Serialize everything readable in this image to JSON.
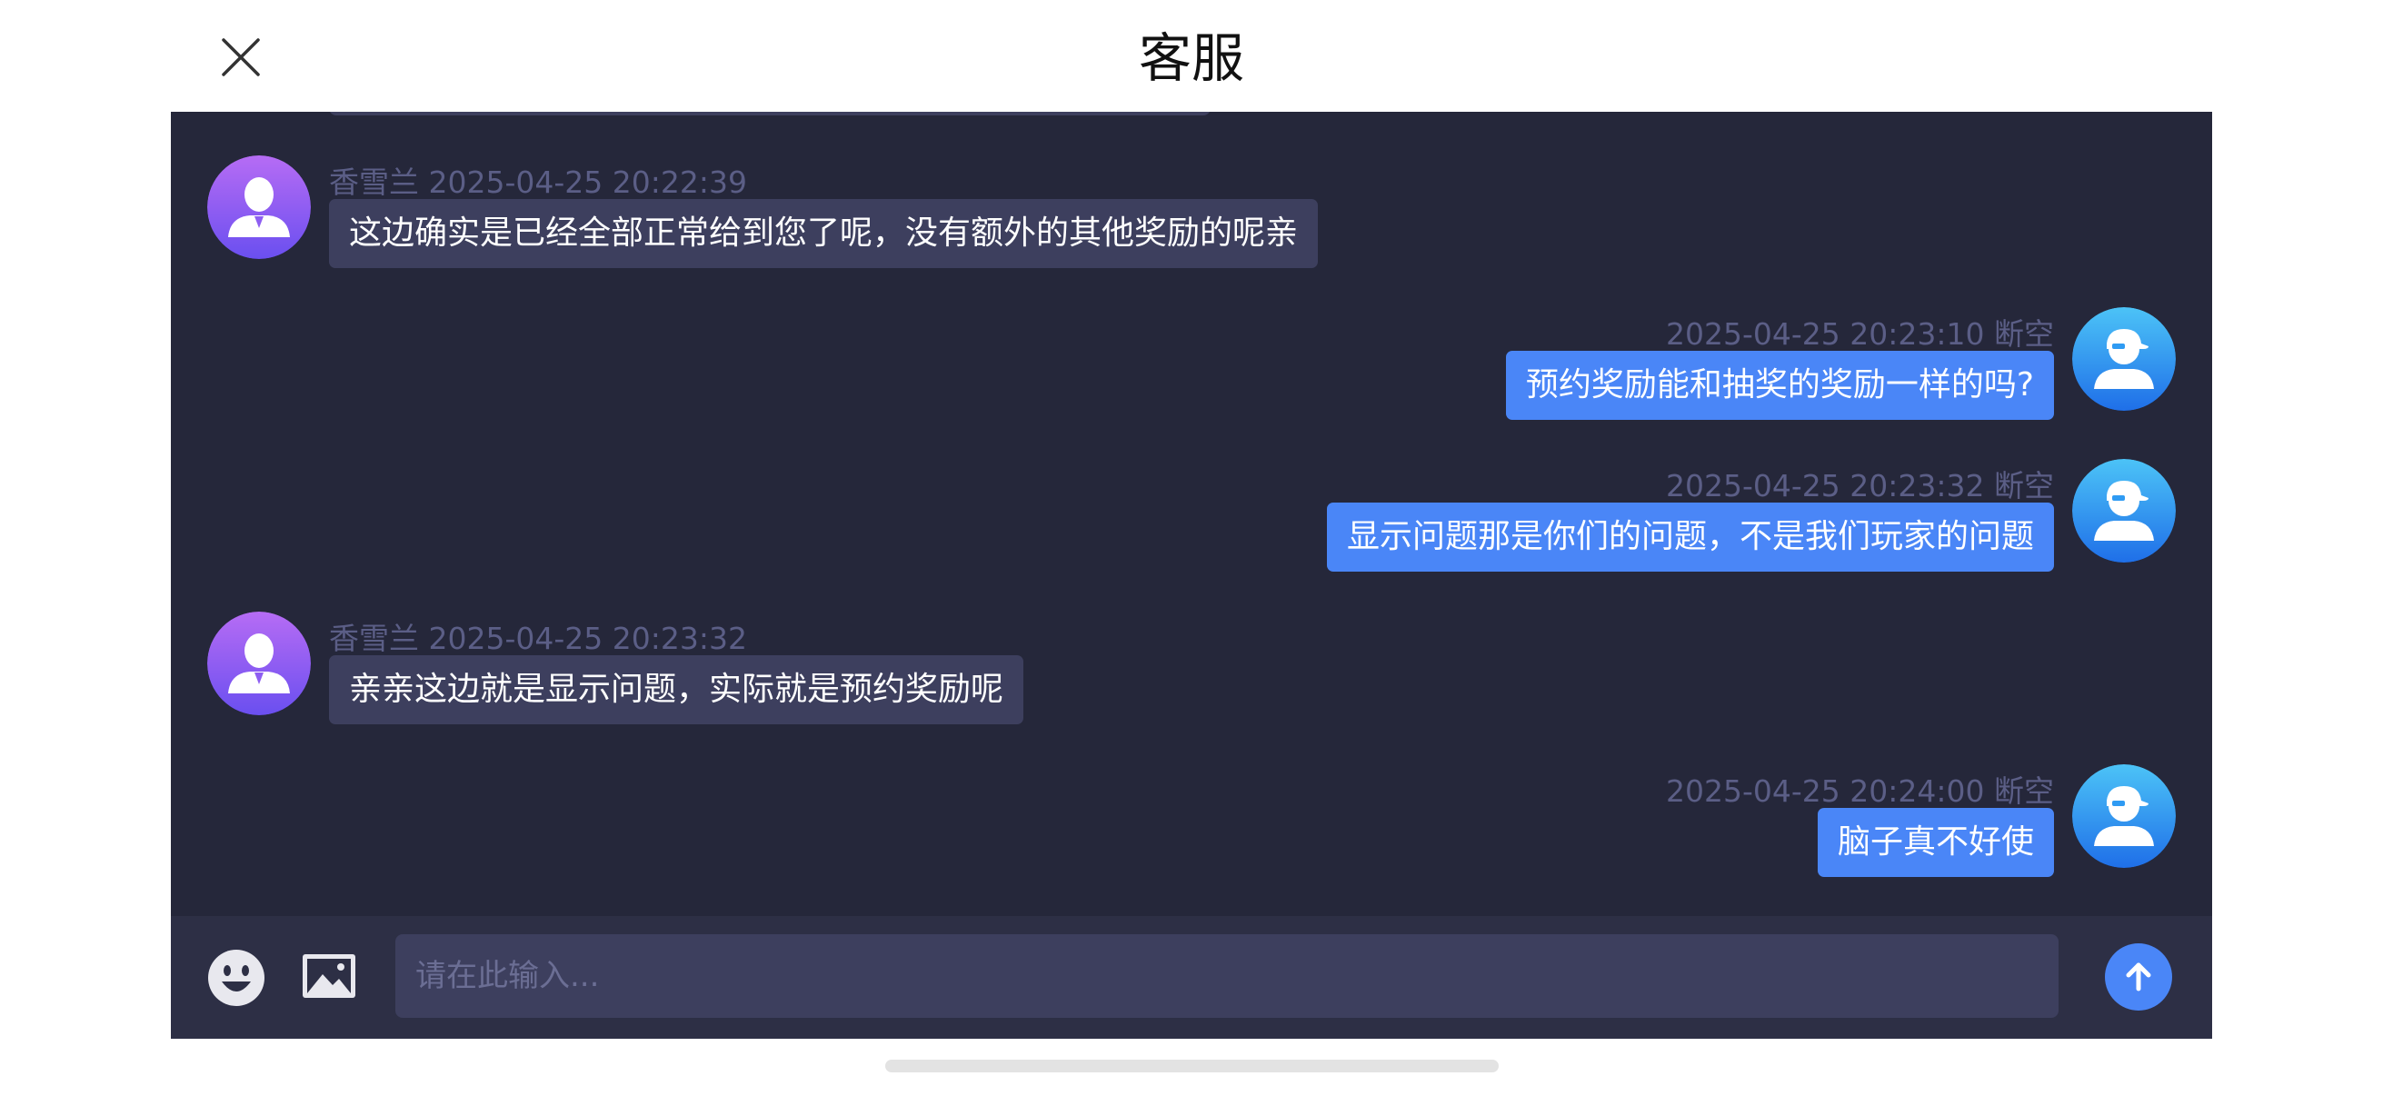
{
  "header": {
    "title": "客服",
    "close_icon": "close-icon"
  },
  "colors": {
    "panel_bg": "#25273a",
    "agent_bubble": "#3d3f5e",
    "user_bubble": "#4a86f7",
    "meta_text": "#5b5e86",
    "agent_avatar": "#8e5ef2",
    "user_avatar": "#2f9bf3"
  },
  "messages": [
    {
      "side": "left",
      "meta": "香雪兰 2025-04-25 20:22:39",
      "text": "这边确实是已经全部正常给到您了呢，没有额外的其他奖励的呢亲",
      "avatar_icon": "agent-avatar-icon"
    },
    {
      "side": "right",
      "meta": "2025-04-25 20:23:10 断空",
      "text": "预约奖励能和抽奖的奖励一样的吗?",
      "avatar_icon": "user-avatar-icon"
    },
    {
      "side": "right",
      "meta": "2025-04-25 20:23:32 断空",
      "text": "显示问题那是你们的问题，不是我们玩家的问题",
      "avatar_icon": "user-avatar-icon"
    },
    {
      "side": "left",
      "meta": "香雪兰 2025-04-25 20:23:32",
      "text": "亲亲这边就是显示问题，实际就是预约奖励呢",
      "avatar_icon": "agent-avatar-icon"
    },
    {
      "side": "right",
      "meta": "2025-04-25 20:24:00 断空",
      "text": "脑子真不好使",
      "avatar_icon": "user-avatar-icon"
    }
  ],
  "input_bar": {
    "emoji_icon": "emoji-icon",
    "image_icon": "image-icon",
    "placeholder": "请在此输入...",
    "value": "",
    "send_icon": "arrow-up-icon"
  }
}
